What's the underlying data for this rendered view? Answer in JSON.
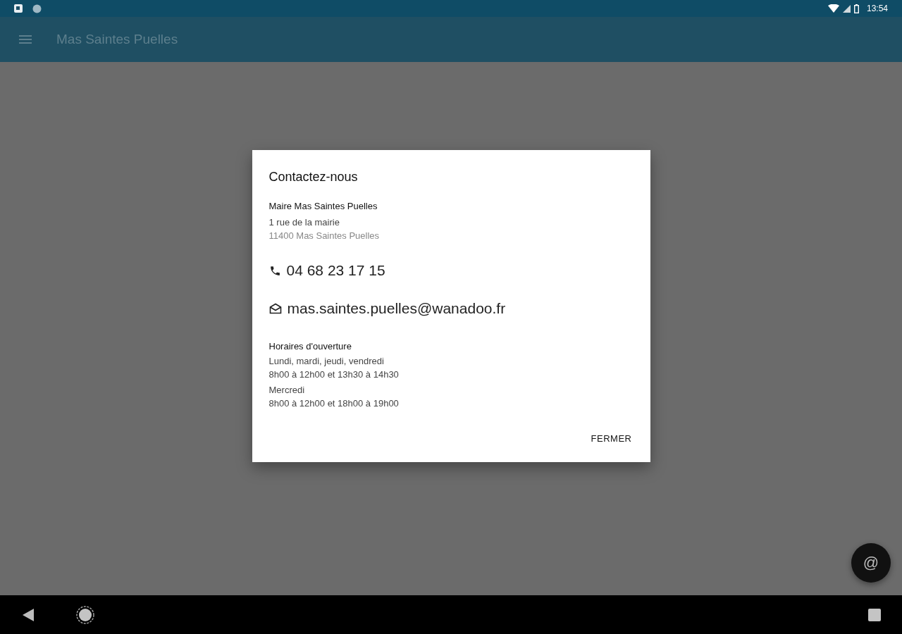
{
  "status_bar": {
    "time": "13:54"
  },
  "app_bar": {
    "title": "Mas Saintes Puelles"
  },
  "dialog": {
    "title": "Contactez-nous",
    "address": {
      "name": "Maire Mas Saintes Puelles",
      "street": "1 rue de la mairie",
      "city": "11400 Mas Saintes Puelles"
    },
    "phone": "04 68 23 17 15",
    "email": "mas.saintes.puelles@wanadoo.fr",
    "hours": {
      "title": "Horaires d'ouverture",
      "groups": [
        {
          "days": "Lundi, mardi, jeudi, vendredi",
          "times": "8h00 à 12h00 et 13h30 à 14h30"
        },
        {
          "days": "Mercredi",
          "times": "8h00 à 12h00 et 18h00 à 19h00"
        }
      ]
    },
    "button": "FERMER"
  },
  "fab": {
    "label": "@"
  }
}
